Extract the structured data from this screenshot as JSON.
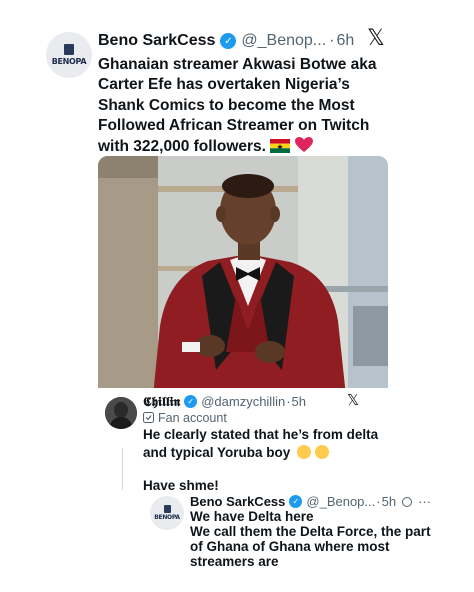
{
  "post": {
    "author_name": "Beno SarkCess",
    "handle": "@_Benop...",
    "separator": "·",
    "time": "6h",
    "avatar_brand": "BENOPA",
    "text_lines": [
      "Ghanaian streamer Akwasi Botwe aka",
      "Carter Efe has overtaken Nigeria’s",
      "Shank Comics to become the Most",
      "Followed African Streamer on Twitch",
      "with 322,000 followers."
    ],
    "x_icon": "𝕏"
  },
  "quoted": {
    "author_name": "𝕮𝖍𝖎𝖑𝖑𝖎𝖓",
    "handle": "@damzychillin",
    "separator": "·",
    "time": "5h",
    "label": "Fan account",
    "text_lines": [
      "He clearly stated that he’s from delta",
      "and typical Yoruba boy"
    ],
    "text_end": "Have sh",
    "text_end2": "me!",
    "x_icon": "𝕏"
  },
  "reply": {
    "author_name": "Beno SarkCess",
    "handle": "@_Benop...",
    "separator": "·",
    "time": "5h",
    "more": "···",
    "avatar_brand": "BENOPA",
    "text_lines": [
      "We have Delta here",
      "We call them the Delta Force, the part",
      "of Ghana of Ghana where most",
      "streamers are"
    ]
  },
  "icons": {
    "verified": "verified-badge-icon",
    "grok": "grok-icon",
    "flag": "ghana-flag-icon",
    "heart": "red-heart-icon",
    "laugh": "laughing-emoji-icon"
  },
  "colors": {
    "verified_blue": "#1d9bf0",
    "text": "#0f1419",
    "muted": "#536471",
    "suit_red": "#8f1d22"
  }
}
